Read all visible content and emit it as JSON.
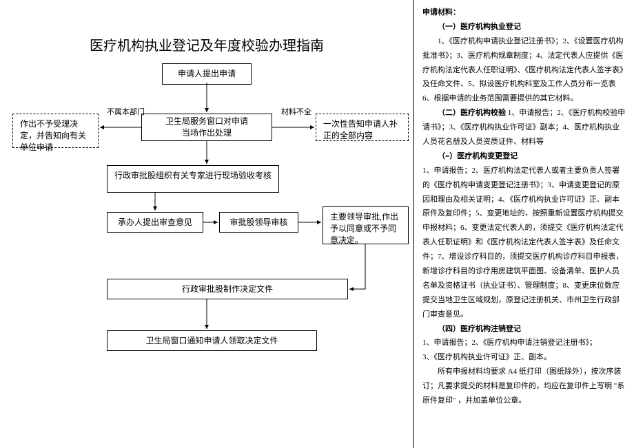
{
  "title": "医疗机构执业登记及年度校验办理指南",
  "flow": {
    "box_apply": "申请人提出申请",
    "box_reject": "作出不予受理决定，并告知向有关单位申请",
    "box_window": "卫生局服务窗口对申请\n当场作出处理",
    "box_supplement": "一次性告知申请人补正的全部内容",
    "box_expert": "行政审批股组织有关专家进行现场验收考核",
    "box_opinion": "承办人提出审查意见",
    "box_leader_review": "审批股领导审核",
    "box_leader_approve": "主要领导审批,作出予以同意或不予同意决定。",
    "box_decision": "行政审批股制作决定文件",
    "box_notify": "卫生局窗口通知申请人领取决定文件",
    "label_not_dept": "不属本部门",
    "label_incomplete": "材料不全"
  },
  "materials": {
    "header": "申请材料：",
    "s1_title": "（一）医疗机构执业登记",
    "s1_body": "1、《医疗机构申请执业登记注册书》；2、《设置医疗机构批准书》；3、医疗机构规章制度；4、法定代表人应提供《医疗机构法定代表人任职证明》、《医疗机构法定代表人签字表》及任命文件、5、拟设医疗机构科室及工作人员分布一览表 6、根据申请的业务范围需要提供的其它材料。",
    "s2_title": "（二）医疗机构校验",
    "s2_body": " 1、申请报告；2、《医疗机构校验申请书》；3、《医疗机构执业许可证》副本；4、医疗机构执业人员花名册及人员资质证件、材料等",
    "s3_title": "（=）医疗机构变更登记",
    "s3_body": "1、申请报告；2、医疗机构法定代表人或者主要负责人签署的《医疗机构申请变更登记注册书》；3、申请变更登记的原因和理由及相关证明；4、《医疗机构执业许可证》正、副本原件及复印件；5、变更地址的，按照重新设置医疗机构提交申报材料；6、变更法定代表人的，须提交《医疗机构法定代表人任职证明》和《医疗机构法定代表人签字表》及任命文件；7、增设诊疗科目的，须提交医疗机构诊疗科目申报表，新增诊疗科目的诊疗用房建筑平面图、设备清单、医护人员名单及资格证书（执业证书）、管理制度；8、变更床位数应提交当地卫生区域规划，原登记注册机关、市州卫生行政部门审查意见。",
    "s4_title": "（四）医疗机构注销登记",
    "s4_body1": "1、申请报告；2、《医疗机构申请注销登记注册书》；",
    "s4_body2": "3、《医疗机构执业许可证》正、副本。",
    "footer": "所有申报材料均要求 A4 纸打印（图纸除外），按次序装订；凡要求提交的材料是复印件的，均应在复印件上写明 \"系原件复印\" ，并加盖单位公章。"
  }
}
